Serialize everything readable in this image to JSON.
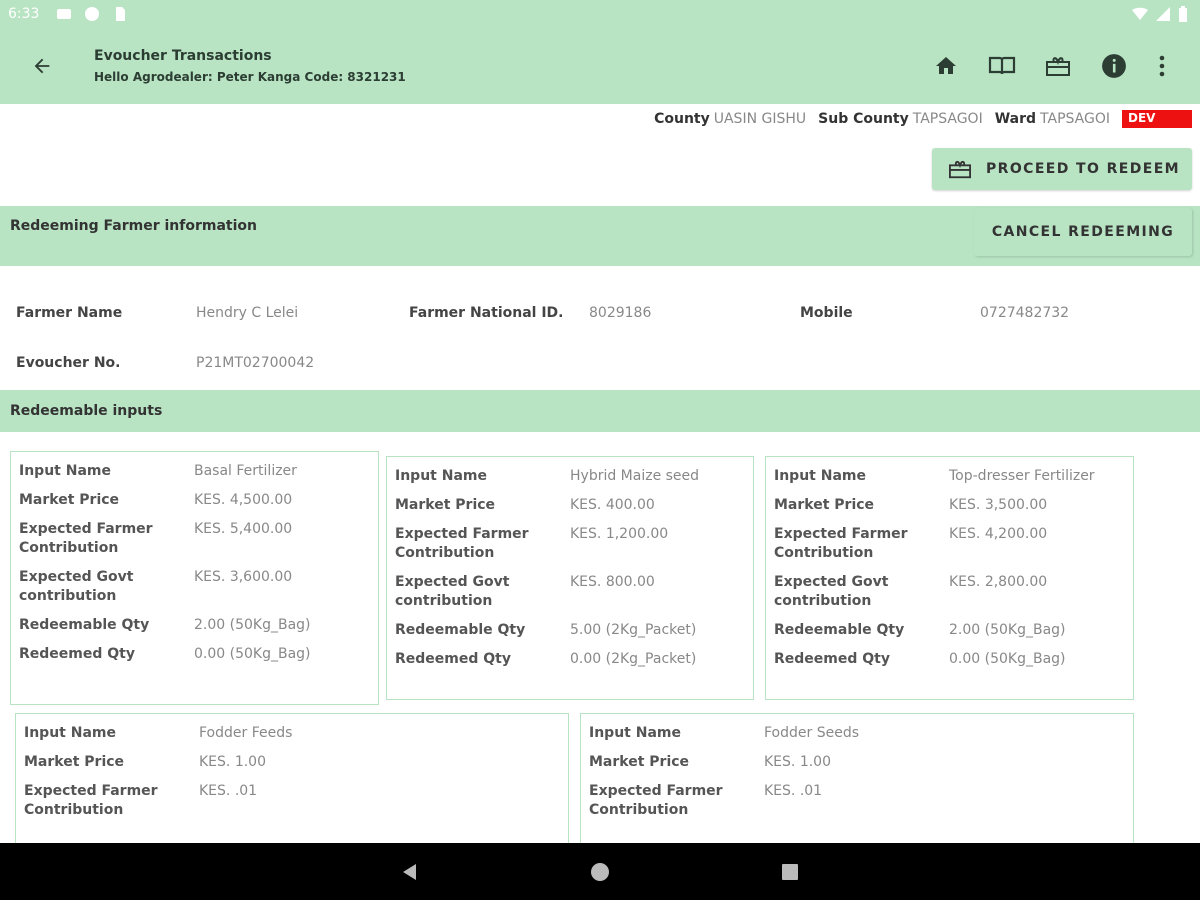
{
  "status_bar": {
    "time": "6:33"
  },
  "appbar": {
    "title": "Evoucher Transactions",
    "subtitle": "Hello Agrodealer: Peter Kanga Code: 8321231"
  },
  "location": {
    "county_label": "County",
    "county": "UASIN GISHU",
    "subcounty_label": "Sub County",
    "subcounty": "TAPSAGOI",
    "ward_label": "Ward",
    "ward": "TAPSAGOI",
    "env_badge": "DEV"
  },
  "proceed_label": "PROCEED TO REDEEM",
  "farmer_section": {
    "title": "Redeeming Farmer information",
    "cancel_label": "CANCEL REDEEMING"
  },
  "farmer": {
    "name_label": "Farmer Name",
    "name": "Hendry C Lelei",
    "id_label": "Farmer National ID.",
    "id": "8029186",
    "mobile_label": "Mobile",
    "mobile": "0727482732",
    "evoucher_label": "Evoucher No.",
    "evoucher": "P21MT02700042"
  },
  "inputs_section": {
    "title": "Redeemable inputs"
  },
  "field_labels": {
    "input_name": "Input Name",
    "market_price": "Market Price",
    "farmer_contribution": "Expected Farmer Contribution",
    "govt_contribution": "Expected Govt contribution",
    "redeemable_qty": "Redeemable Qty",
    "redeemed_qty": "Redeemed Qty"
  },
  "inputs": [
    {
      "name": "Basal Fertilizer",
      "market_price": "KES. 4,500.00",
      "farmer_contribution": "KES. 5,400.00",
      "govt_contribution": "KES. 3,600.00",
      "redeemable_qty": "2.00 (50Kg_Bag)",
      "redeemed_qty": "0.00 (50Kg_Bag)"
    },
    {
      "name": "Hybrid Maize seed",
      "market_price": "KES. 400.00",
      "farmer_contribution": "KES. 1,200.00",
      "govt_contribution": "KES. 800.00",
      "redeemable_qty": "5.00 (2Kg_Packet)",
      "redeemed_qty": "0.00 (2Kg_Packet)"
    },
    {
      "name": "Top-dresser Fertilizer",
      "market_price": "KES. 3,500.00",
      "farmer_contribution": "KES. 4,200.00",
      "govt_contribution": "KES. 2,800.00",
      "redeemable_qty": "2.00 (50Kg_Bag)",
      "redeemed_qty": "0.00 (50Kg_Bag)"
    },
    {
      "name": "Fodder Feeds",
      "market_price": "KES. 1.00",
      "farmer_contribution": "KES. .01"
    },
    {
      "name": "Fodder Seeds",
      "market_price": "KES. 1.00",
      "farmer_contribution": "KES. .01"
    }
  ],
  "colors": {
    "accent": "#b8e4c4",
    "dev_badge": "#ee1111"
  }
}
